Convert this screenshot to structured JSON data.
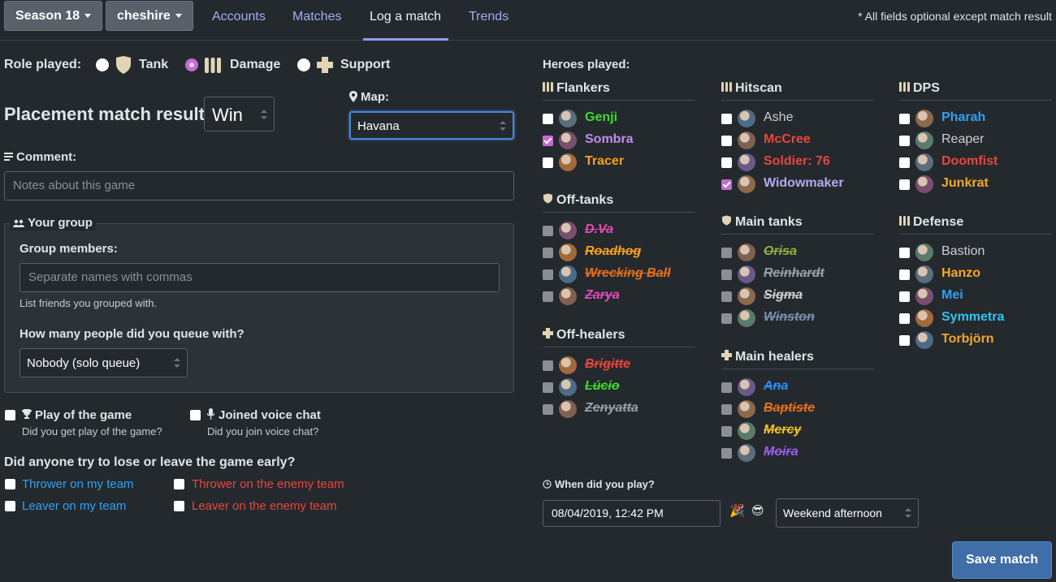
{
  "nav": {
    "season": "Season 18",
    "account": "cheshire",
    "tabs": [
      "Accounts",
      "Matches",
      "Log a match",
      "Trends"
    ],
    "note": "* All fields optional except match result"
  },
  "role": {
    "label": "Role played:",
    "options": [
      "Tank",
      "Damage",
      "Support"
    ],
    "selected": "Damage"
  },
  "result": {
    "label": "Placement match result:",
    "value": "Win"
  },
  "map": {
    "label": "Map:",
    "value": "Havana"
  },
  "comment": {
    "label": "Comment:",
    "placeholder": "Notes about this game"
  },
  "group": {
    "legend": "Your group",
    "members_label": "Group members:",
    "members_placeholder": "Separate names with commas",
    "members_help": "List friends you grouped with.",
    "queue_label": "How many people did you queue with?",
    "queue_value": "Nobody (solo queue)"
  },
  "potg": {
    "label": "Play of the game",
    "help": "Did you get play of the game?"
  },
  "voice": {
    "label": "Joined voice chat",
    "help": "Did you join voice chat?"
  },
  "leavers": {
    "question": "Did anyone try to lose or leave the game early?",
    "thrower_mine": "Thrower on my team",
    "thrower_enemy": "Thrower on the enemy team",
    "leaver_mine": "Leaver on my team",
    "leaver_enemy": "Leaver on the enemy team"
  },
  "heroes": {
    "label": "Heroes played:",
    "groups": [
      {
        "name": "Flankers",
        "heroes": [
          {
            "name": "Genji",
            "color": "#3ddc2e",
            "checked": false
          },
          {
            "name": "Sombra",
            "color": "#c08ee8",
            "checked": true
          },
          {
            "name": "Tracer",
            "color": "#f6a11c",
            "checked": false
          }
        ]
      },
      {
        "name": "Hitscan",
        "heroes": [
          {
            "name": "Ashe",
            "color": "#d0d0d0",
            "checked": false
          },
          {
            "name": "McCree",
            "color": "#e8463c",
            "checked": false
          },
          {
            "name": "Soldier: 76",
            "color": "#e8463c",
            "checked": false
          },
          {
            "name": "Widowmaker",
            "color": "#b9a7f0",
            "checked": true
          }
        ]
      },
      {
        "name": "DPS",
        "heroes": [
          {
            "name": "Pharah",
            "color": "#2ea3f2",
            "checked": false
          },
          {
            "name": "Reaper",
            "color": "#d0d0d0",
            "checked": false
          },
          {
            "name": "Doomfist",
            "color": "#e8463c",
            "checked": false
          },
          {
            "name": "Junkrat",
            "color": "#f1a928",
            "checked": false
          }
        ]
      },
      {
        "name": "Off-tanks",
        "heroes": [
          {
            "name": "D.Va",
            "color": "#e24bb3"
          },
          {
            "name": "Roadhog",
            "color": "#f6a11c"
          },
          {
            "name": "Wrecking Ball",
            "color": "#e8701c"
          },
          {
            "name": "Zarya",
            "color": "#e24bb3"
          }
        ]
      },
      {
        "name": "Main tanks",
        "heroes": [
          {
            "name": "Orisa",
            "color": "#8fb33a"
          },
          {
            "name": "Reinhardt",
            "color": "#9aa0a6"
          },
          {
            "name": "Sigma",
            "color": "#d0d0d0"
          },
          {
            "name": "Winston",
            "color": "#7d8fb0"
          }
        ]
      },
      {
        "name": "Defense",
        "heroes": [
          {
            "name": "Bastion",
            "color": "#d0d0d0",
            "checked": false
          },
          {
            "name": "Hanzo",
            "color": "#f1a928",
            "checked": false
          },
          {
            "name": "Mei",
            "color": "#2ea3f2",
            "checked": false
          },
          {
            "name": "Symmetra",
            "color": "#2ec4f2",
            "checked": false
          },
          {
            "name": "Torbjörn",
            "color": "#f1a928",
            "checked": false
          }
        ]
      },
      {
        "name": "Off-healers",
        "heroes": [
          {
            "name": "Brigitte",
            "color": "#e8463c"
          },
          {
            "name": "Lúcio",
            "color": "#3ddc2e"
          },
          {
            "name": "Zenyatta",
            "color": "#9aa0a6"
          }
        ]
      },
      {
        "name": "Main healers",
        "heroes": [
          {
            "name": "Ana",
            "color": "#2e8ef2"
          },
          {
            "name": "Baptiste",
            "color": "#e8701c"
          },
          {
            "name": "Mercy",
            "color": "#f6c11c"
          },
          {
            "name": "Moira",
            "color": "#9a5ce8"
          }
        ]
      }
    ]
  },
  "when": {
    "label": "When did you play?",
    "datetime": "08/04/2019, 12:42 PM",
    "emoji": [
      "🎉",
      "😎"
    ],
    "period": "Weekend afternoon"
  },
  "save": "Save match",
  "colors": {
    "accent": "#3f6ea8",
    "checked": "#c46bd0",
    "link": "#9fb0f0",
    "blue_text": "#2ea3f2",
    "red_text": "#e8463c"
  }
}
